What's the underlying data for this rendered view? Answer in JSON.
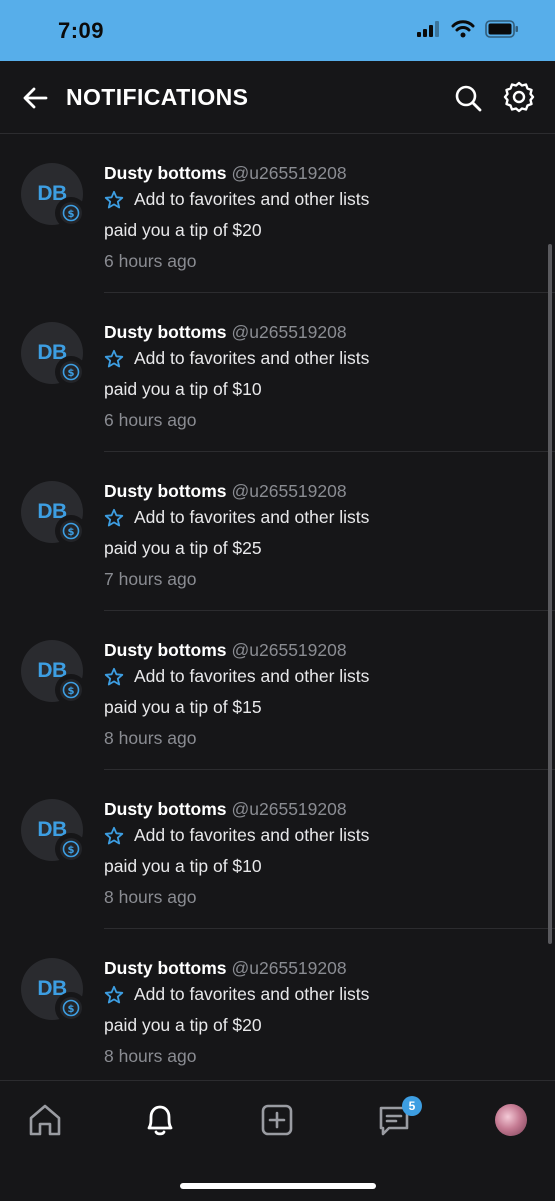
{
  "status": {
    "time": "7:09"
  },
  "header": {
    "title": "NOTIFICATIONS"
  },
  "notifications": [
    {
      "initials": "DB",
      "name": "Dusty bottoms",
      "handle": "@u265519208",
      "fav_label": "Add to favorites and other lists",
      "message": "paid you a tip of $20",
      "time": "6 hours ago"
    },
    {
      "initials": "DB",
      "name": "Dusty bottoms",
      "handle": "@u265519208",
      "fav_label": "Add to favorites and other lists",
      "message": "paid you a tip of $10",
      "time": "6 hours ago"
    },
    {
      "initials": "DB",
      "name": "Dusty bottoms",
      "handle": "@u265519208",
      "fav_label": "Add to favorites and other lists",
      "message": "paid you a tip of $25",
      "time": "7 hours ago"
    },
    {
      "initials": "DB",
      "name": "Dusty bottoms",
      "handle": "@u265519208",
      "fav_label": "Add to favorites and other lists",
      "message": "paid you a tip of $15",
      "time": "8 hours ago"
    },
    {
      "initials": "DB",
      "name": "Dusty bottoms",
      "handle": "@u265519208",
      "fav_label": "Add to favorites and other lists",
      "message": "paid you a tip of $10",
      "time": "8 hours ago"
    },
    {
      "initials": "DB",
      "name": "Dusty bottoms",
      "handle": "@u265519208",
      "fav_label": "Add to favorites and other lists",
      "message": "paid you a tip of $20",
      "time": "8 hours ago"
    }
  ],
  "tabbar": {
    "items": [
      "home-icon",
      "bell-icon",
      "add-post-icon",
      "messages-icon",
      "profile-avatar"
    ],
    "active": "bell-icon",
    "messages_badge": "5"
  },
  "colors": {
    "accent": "#3d9ee2",
    "statusbar": "#57aeea",
    "background": "#161618"
  }
}
